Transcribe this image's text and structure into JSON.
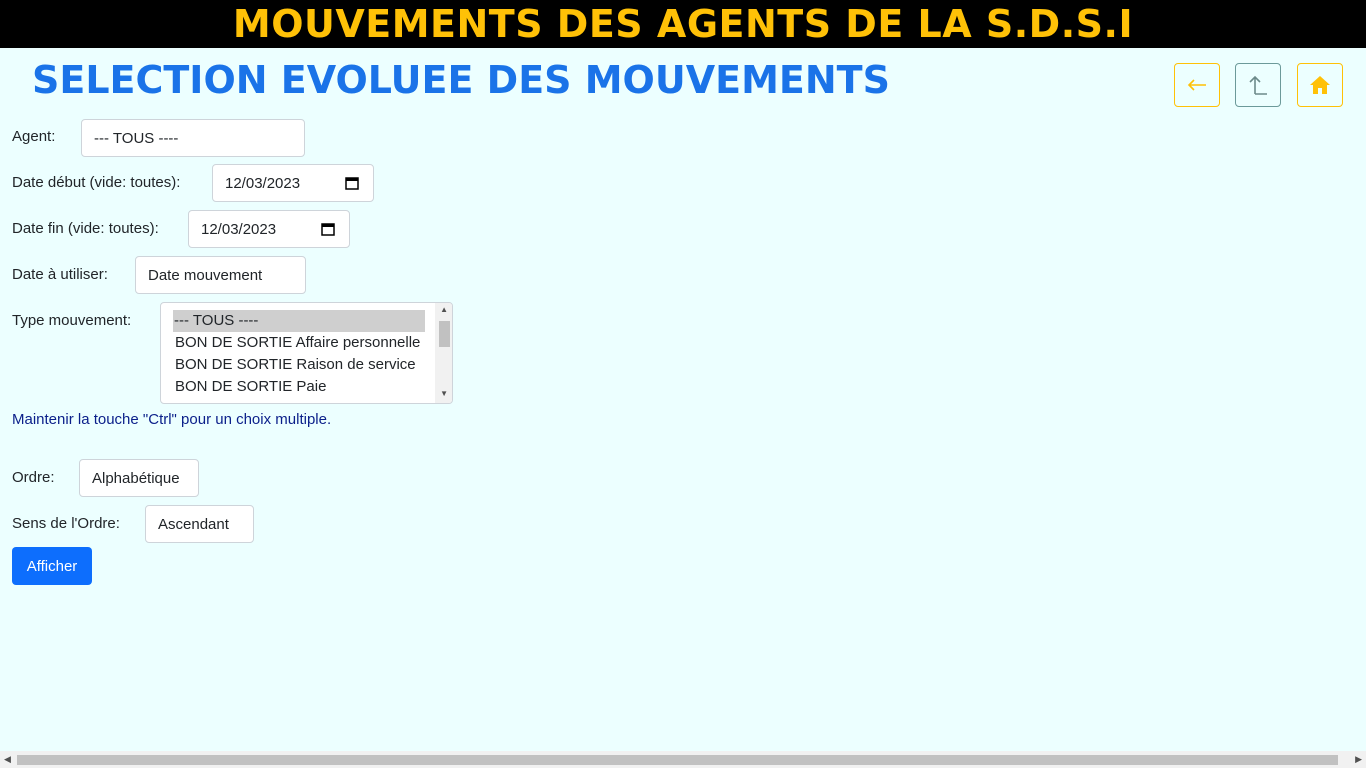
{
  "header": {
    "title": "MOUVEMENTS DES AGENTS DE LA S.D.S.I"
  },
  "page": {
    "title": "SELECTION EVOLUEE DES MOUVEMENTS"
  },
  "nav": {
    "back_icon": "arrow-left-icon",
    "up_icon": "arrow-up-icon",
    "home_icon": "home-icon"
  },
  "form": {
    "agent": {
      "label": "Agent:",
      "value": "--- TOUS ----"
    },
    "date_debut": {
      "label": "Date début (vide: toutes):",
      "value": "12/03/2023"
    },
    "date_fin": {
      "label": "Date fin (vide: toutes):",
      "value": "12/03/2023"
    },
    "date_utiliser": {
      "label": "Date à utiliser:",
      "value": "Date mouvement"
    },
    "type_mouvement": {
      "label": "Type mouvement:",
      "options": [
        "--- TOUS ----",
        "BON DE SORTIE Affaire personnelle",
        "BON DE SORTIE Raison de service",
        "BON DE SORTIE Paie"
      ],
      "selected": "--- TOUS ----"
    },
    "hint": "Maintenir la touche \"Ctrl\" pour un choix multiple.",
    "ordre": {
      "label": "Ordre:",
      "value": "Alphabétique"
    },
    "sens_ordre": {
      "label": "Sens de l'Ordre:",
      "value": "Ascendant"
    },
    "submit_label": "Afficher"
  },
  "colors": {
    "header_bg": "#000000",
    "header_text": "#ffc107",
    "title": "#1a73e8",
    "primary": "#0d6efd",
    "page_bg": "#ecffff"
  }
}
